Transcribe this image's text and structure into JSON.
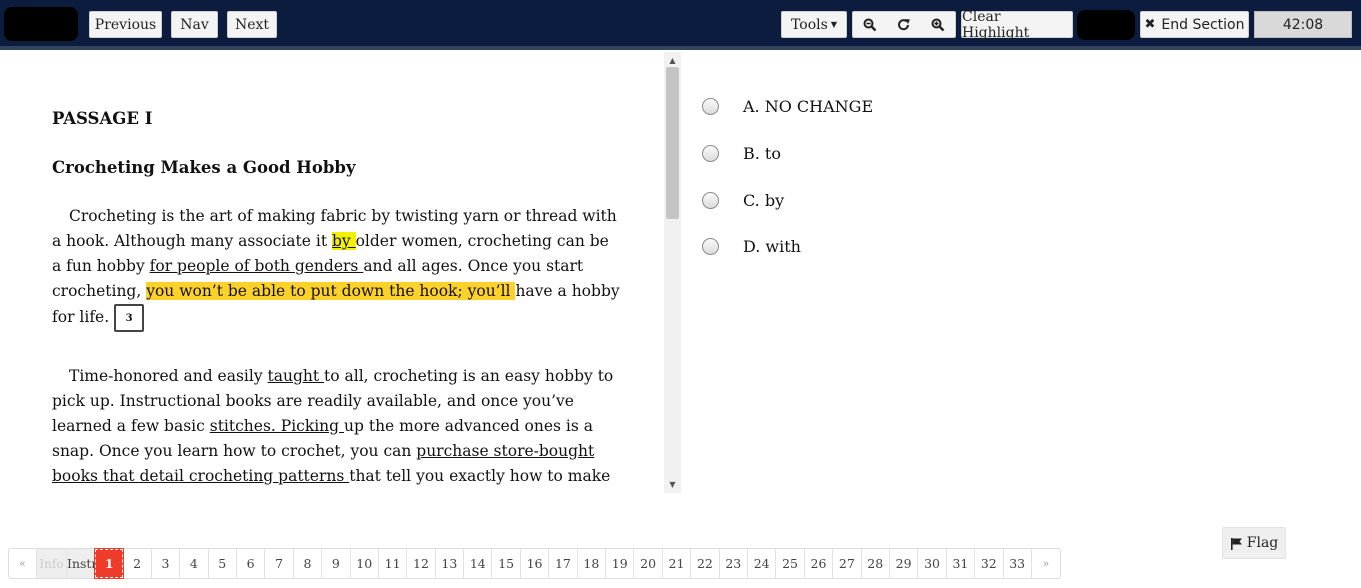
{
  "toolbar": {
    "previous_label": "Previous",
    "nav_label": "Nav",
    "next_label": "Next",
    "tools_label": "Tools",
    "clear_highlight_label": "Clear Highlight",
    "end_section_label": "End Section",
    "timer": "42:08"
  },
  "passage": {
    "label": "PASSAGE I",
    "title": "Crocheting Makes a Good Hobby",
    "p1": {
      "s1": "Crocheting is the art of making fabric by twisting yarn or thread with a hook. Although many associate it ",
      "u1": "by ",
      "s2": "older women, crocheting can be a fun hobby ",
      "u2": "for people of both genders ",
      "s3": "and all ages. Once you start crocheting, ",
      "h1": "you won’t be able to put down the hook; you’ll ",
      "s4": "have a hobby for life.",
      "question_number": "3"
    },
    "p2": {
      "s1": "Time-honored and easily ",
      "u1": "taught ",
      "s2": "to all, crocheting is an easy hobby to pick up. Instructional books are readily available, and once you’ve learned a few basic ",
      "u2": "stitches. Picking ",
      "s3": "up the more advanced ones is a snap. Once you learn how to crochet, you can ",
      "u3": "purchase store-bought books that detail crocheting patterns ",
      "s4": "that tell you exactly how to make"
    }
  },
  "answers": [
    {
      "label": "A. NO CHANGE"
    },
    {
      "label": "B. to"
    },
    {
      "label": "C. by"
    },
    {
      "label": "D. with"
    }
  ],
  "flag_label": "Flag",
  "pager": {
    "prev": "«",
    "next": "»",
    "info": "Info",
    "instr": "Instr",
    "pages": [
      "1",
      "2",
      "3",
      "4",
      "5",
      "6",
      "7",
      "8",
      "9",
      "10",
      "11",
      "12",
      "13",
      "14",
      "15",
      "16",
      "17",
      "18",
      "19",
      "20",
      "21",
      "22",
      "23",
      "24",
      "25",
      "26",
      "27",
      "28",
      "29",
      "30",
      "31",
      "32",
      "33"
    ],
    "current": "1"
  },
  "colors": {
    "topbar": "#0b1c3f",
    "highlight_yellow": "#f2f200",
    "highlight_orange": "#fcd22a",
    "current_page": "#ef3b2a"
  }
}
